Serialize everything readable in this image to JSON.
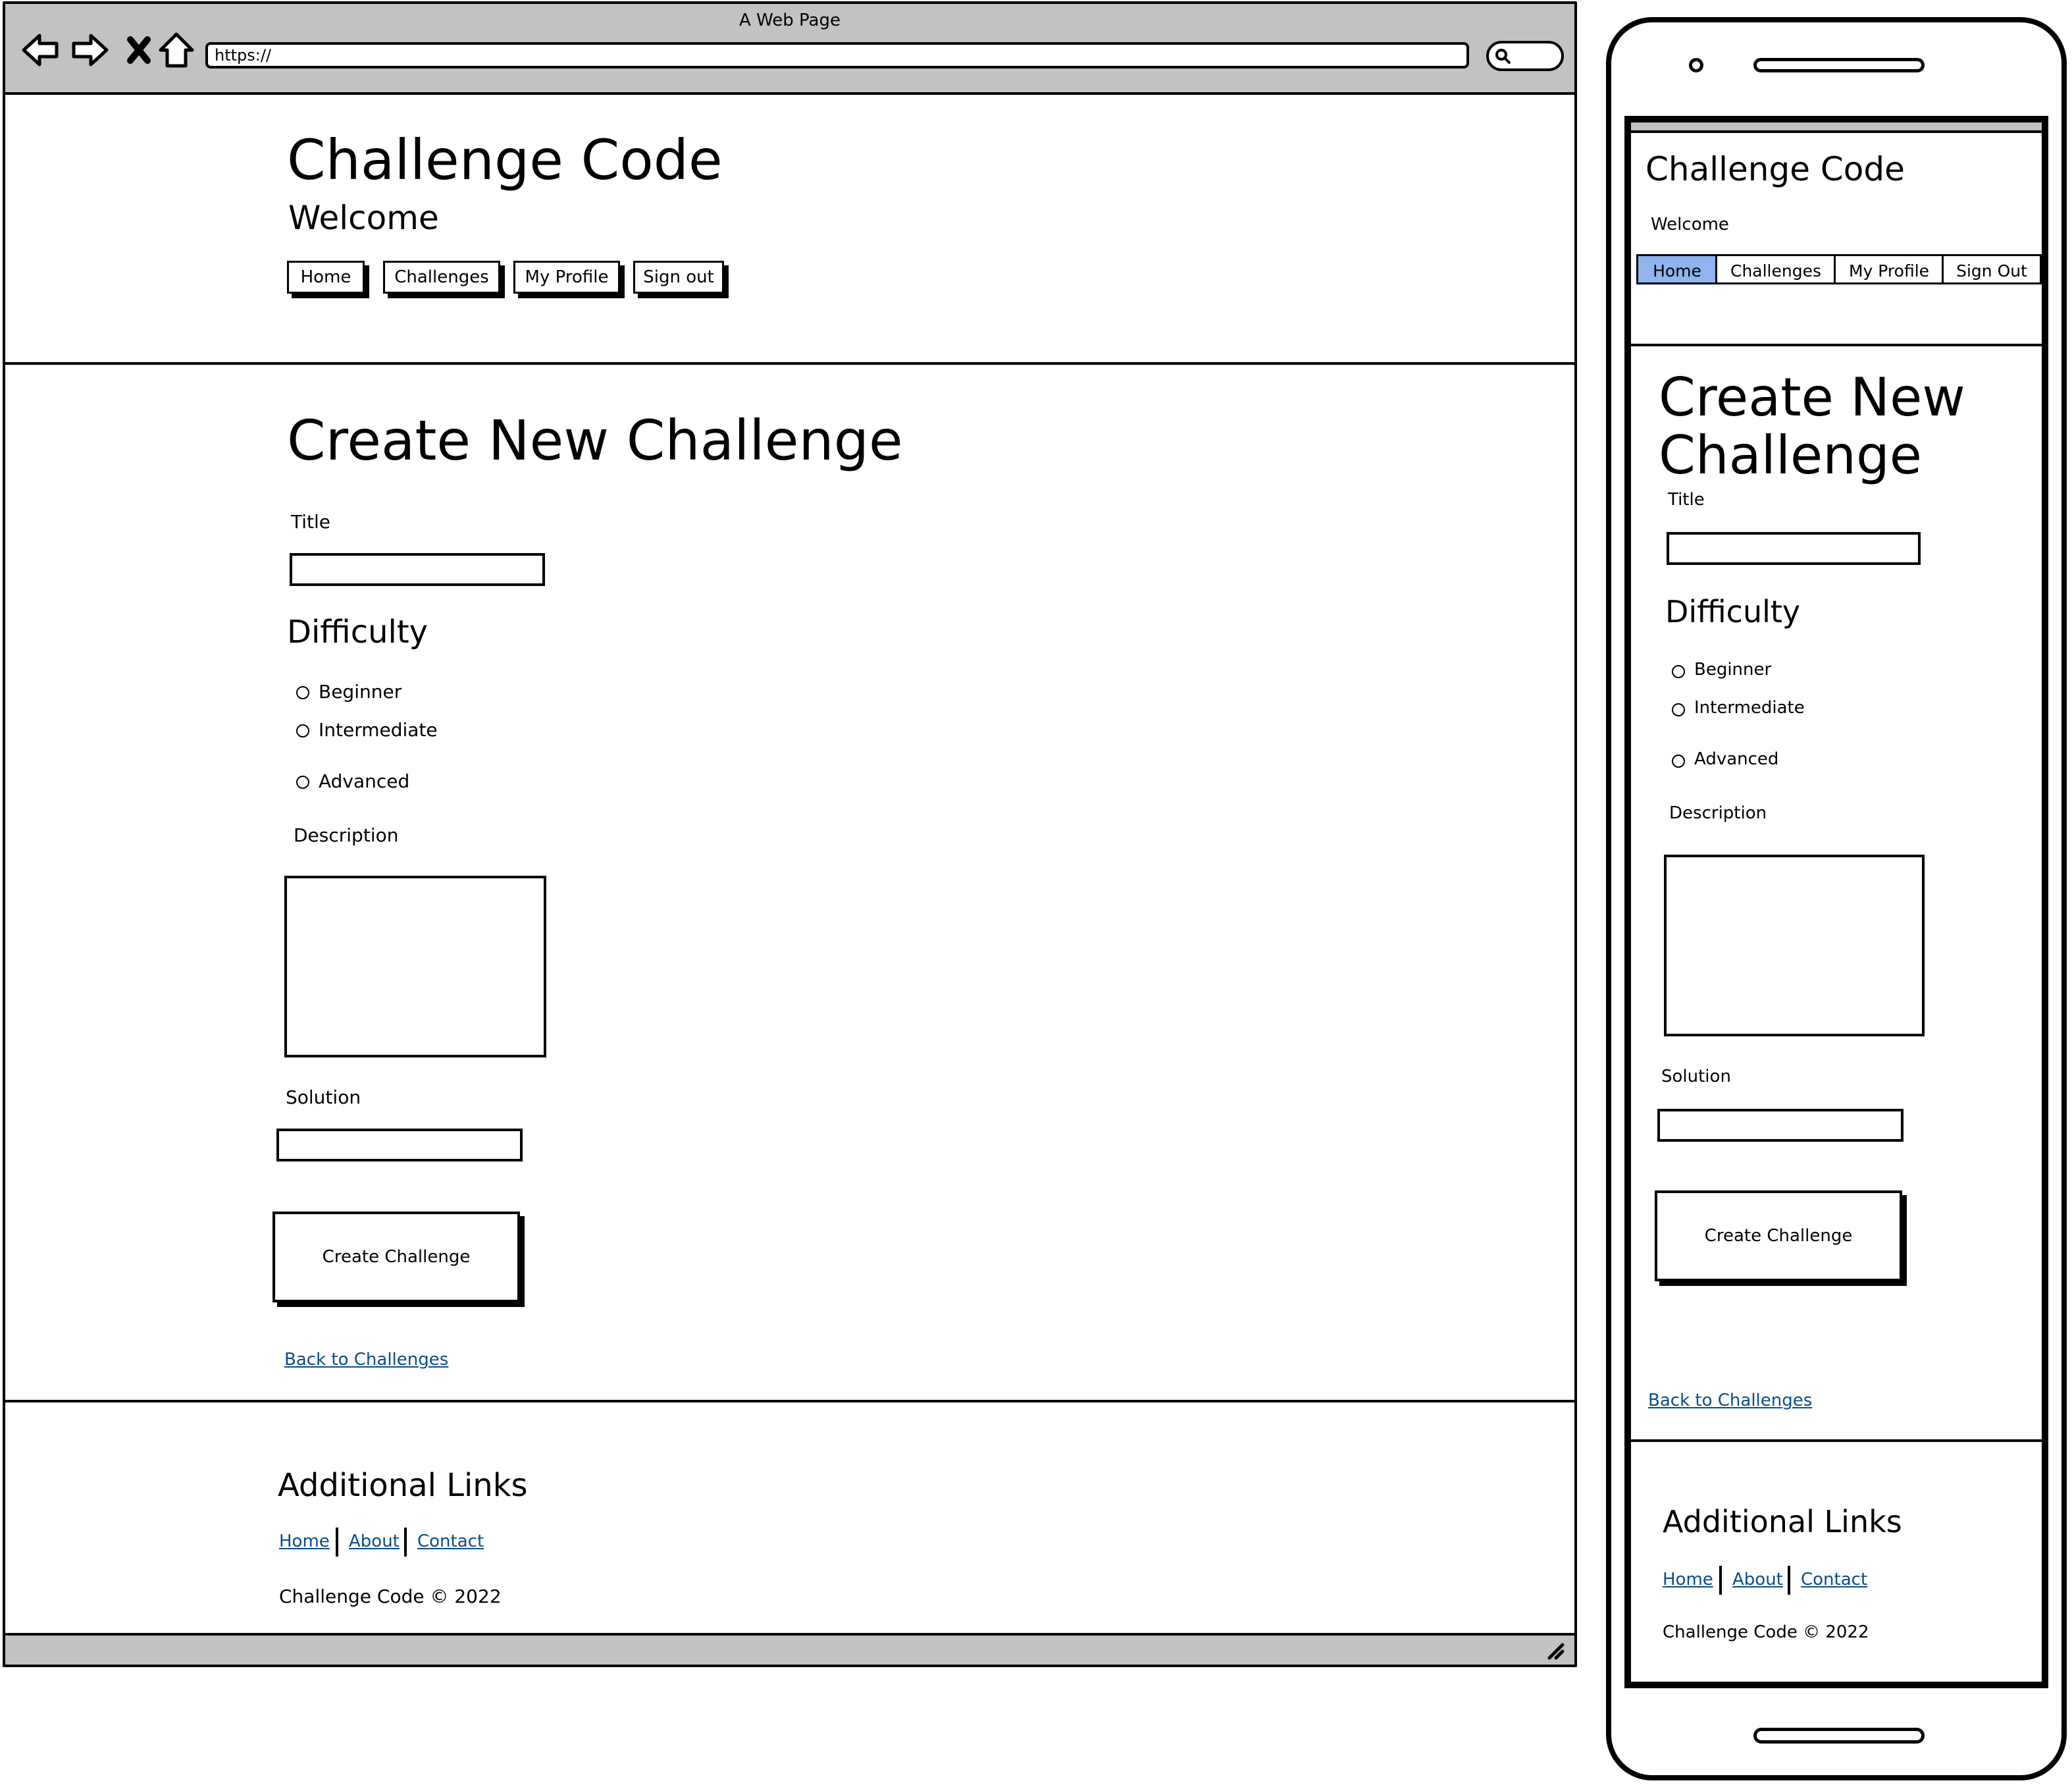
{
  "browser": {
    "title": "A Web Page",
    "url": "https://"
  },
  "site": {
    "title": "Challenge Code",
    "welcome": "Welcome"
  },
  "desktop_nav": [
    "Home",
    "Challenges",
    "My Profile",
    "Sign out"
  ],
  "mobile_nav": {
    "items": [
      "Home",
      "Challenges",
      "My Profile",
      "Sign Out"
    ],
    "active": "Home",
    "active_color": "#8fb4ef"
  },
  "form": {
    "heading": "Create New Challenge",
    "mobile_heading_line1": "Create New",
    "mobile_heading_line2": "Challenge",
    "title_label": "Title",
    "title_value": "",
    "difficulty_heading": "Difficulty",
    "difficulty_options": [
      "Beginner",
      "Intermediate",
      "Advanced"
    ],
    "description_label": "Description",
    "description_value": "",
    "solution_label": "Solution",
    "solution_value": "",
    "submit_label": "Create Challenge",
    "back_link": "Back to Challenges"
  },
  "footer": {
    "heading": "Additional Links",
    "links": [
      "Home",
      "About",
      "Contact"
    ],
    "copyright": "Challenge Code © 2022"
  },
  "colors": {
    "link": "#0b4c8c",
    "chrome": "#c2c2c2"
  }
}
